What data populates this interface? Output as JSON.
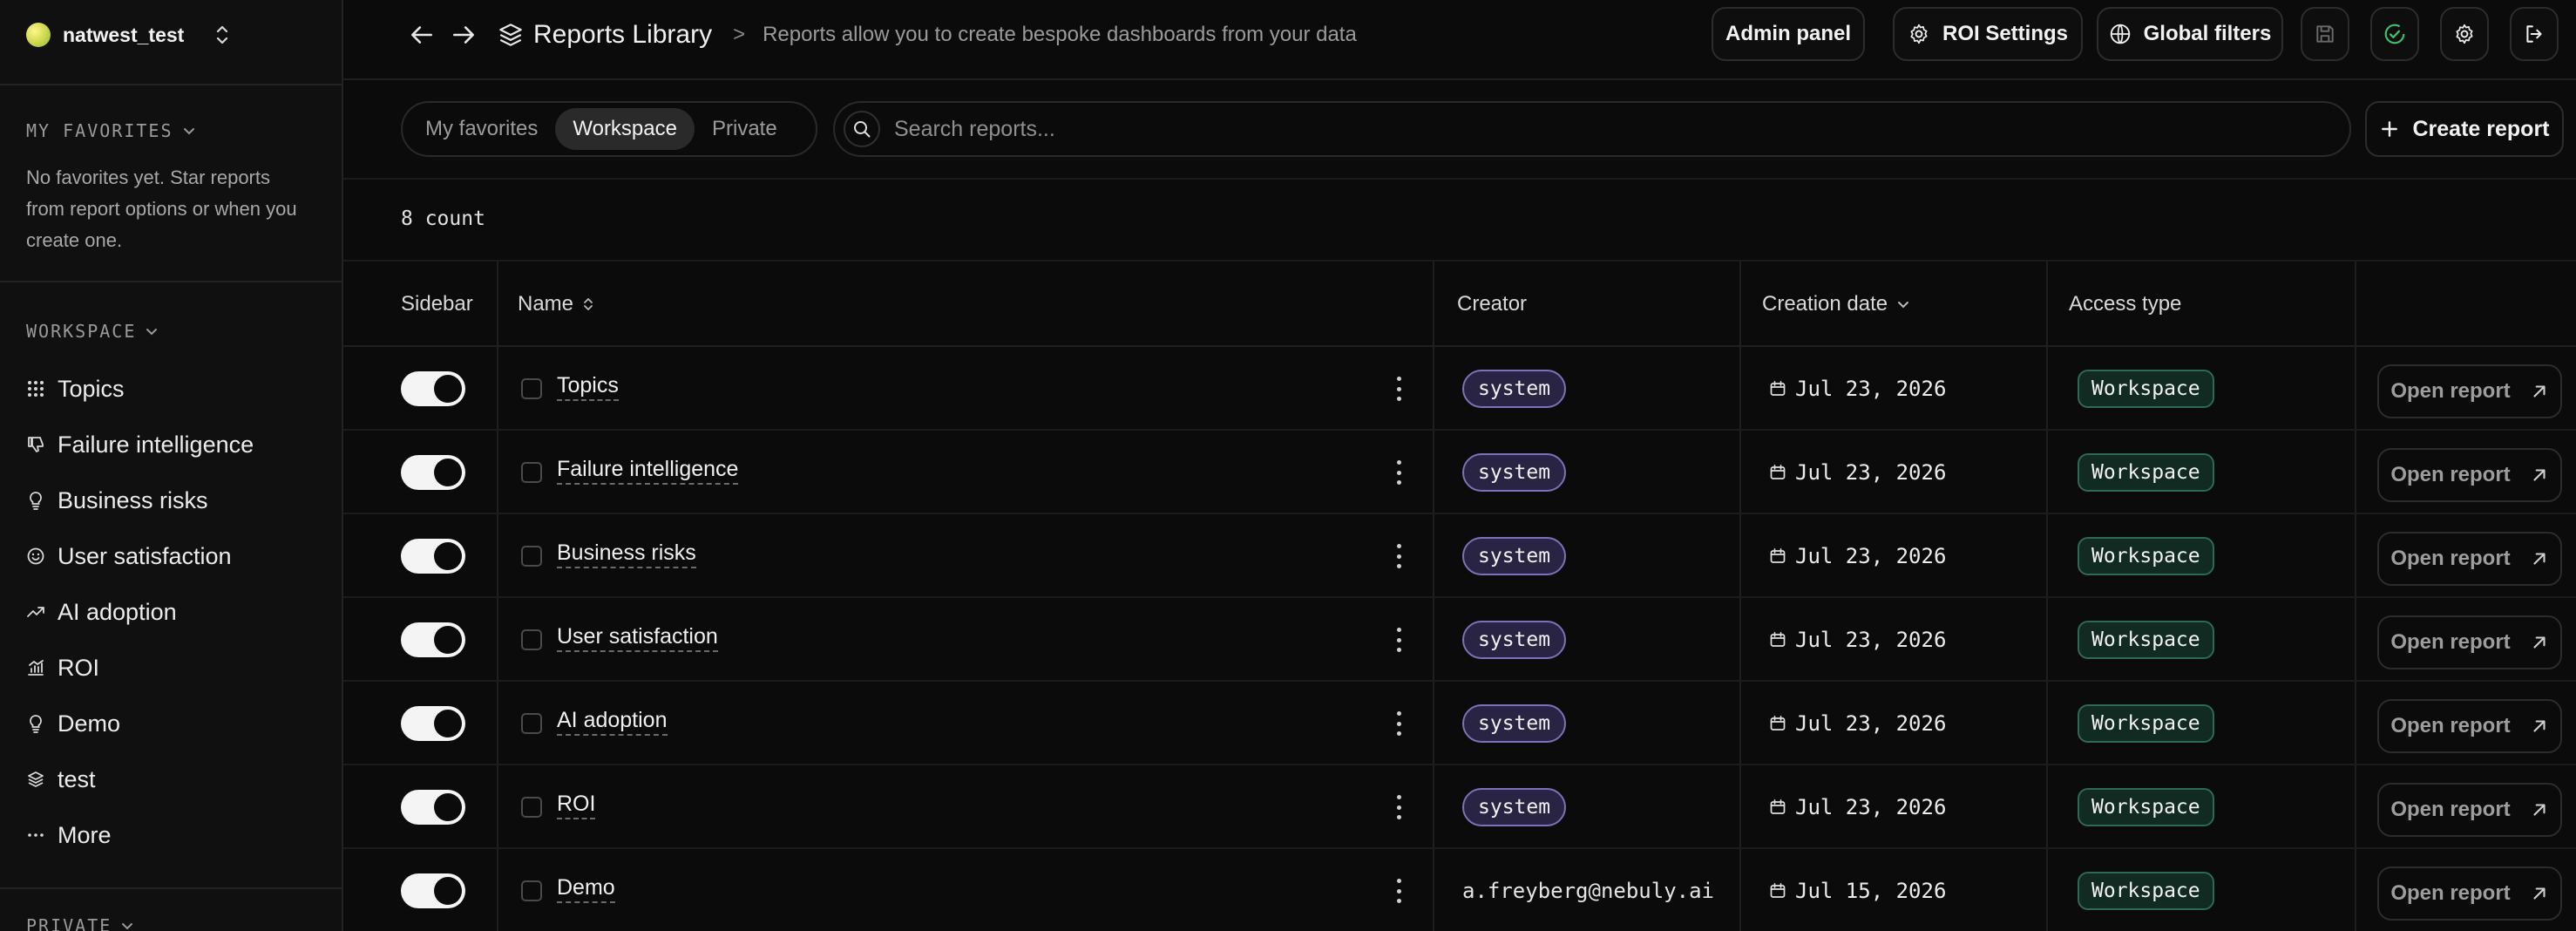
{
  "workspace": {
    "name": "natwest_test"
  },
  "sidebar": {
    "favorites_title": "MY FAVORITES",
    "favorites_empty": "No favorites yet. Star reports from report options or when you create one.",
    "workspace_title": "WORKSPACE",
    "items": [
      {
        "label": "Topics",
        "icon": "grid-dots-icon"
      },
      {
        "label": "Failure intelligence",
        "icon": "thumbs-down-icon"
      },
      {
        "label": "Business risks",
        "icon": "lightbulb-icon"
      },
      {
        "label": "User satisfaction",
        "icon": "smile-icon"
      },
      {
        "label": "AI adoption",
        "icon": "trend-up-icon"
      },
      {
        "label": "ROI",
        "icon": "chart-icon"
      },
      {
        "label": "Demo",
        "icon": "lightbulb-icon"
      },
      {
        "label": "test",
        "icon": "layers-icon"
      },
      {
        "label": "More",
        "icon": "more-dots-icon"
      }
    ],
    "private_title": "PRIVATE"
  },
  "header": {
    "title": "Reports Library",
    "separator": ">",
    "subtitle": "Reports allow you to create bespoke dashboards from your data",
    "admin_panel": "Admin panel",
    "roi_settings": "ROI Settings",
    "global_filters": "Global filters"
  },
  "filters": {
    "tabs": [
      "My favorites",
      "Workspace",
      "Private"
    ],
    "active": "Workspace"
  },
  "search": {
    "placeholder": "Search reports..."
  },
  "create_report": "Create report",
  "count_label": "8 count",
  "table": {
    "columns": {
      "sidebar": "Sidebar",
      "name": "Name",
      "creator": "Creator",
      "creation_date": "Creation date",
      "access_type": "Access type"
    },
    "open_label": "Open report",
    "rows": [
      {
        "name": "Topics",
        "creator": "system",
        "creator_is_badge": true,
        "date": "Jul 23, 2026",
        "access": "Workspace",
        "sidebar_on": true
      },
      {
        "name": "Failure intelligence",
        "creator": "system",
        "creator_is_badge": true,
        "date": "Jul 23, 2026",
        "access": "Workspace",
        "sidebar_on": true
      },
      {
        "name": "Business risks",
        "creator": "system",
        "creator_is_badge": true,
        "date": "Jul 23, 2026",
        "access": "Workspace",
        "sidebar_on": true
      },
      {
        "name": "User satisfaction",
        "creator": "system",
        "creator_is_badge": true,
        "date": "Jul 23, 2026",
        "access": "Workspace",
        "sidebar_on": true
      },
      {
        "name": "AI adoption",
        "creator": "system",
        "creator_is_badge": true,
        "date": "Jul 23, 2026",
        "access": "Workspace",
        "sidebar_on": true
      },
      {
        "name": "ROI",
        "creator": "system",
        "creator_is_badge": true,
        "date": "Jul 23, 2026",
        "access": "Workspace",
        "sidebar_on": true
      },
      {
        "name": "Demo",
        "creator": "a.freyberg@nebuly.ai",
        "creator_is_badge": false,
        "date": "Jul 15, 2026",
        "access": "Workspace",
        "sidebar_on": true
      }
    ]
  },
  "colors": {
    "background": "#0b0b0b",
    "creator_badge_border": "#7b72b8",
    "access_badge_border": "#2d6a55",
    "status_green": "#3fbf6a"
  }
}
